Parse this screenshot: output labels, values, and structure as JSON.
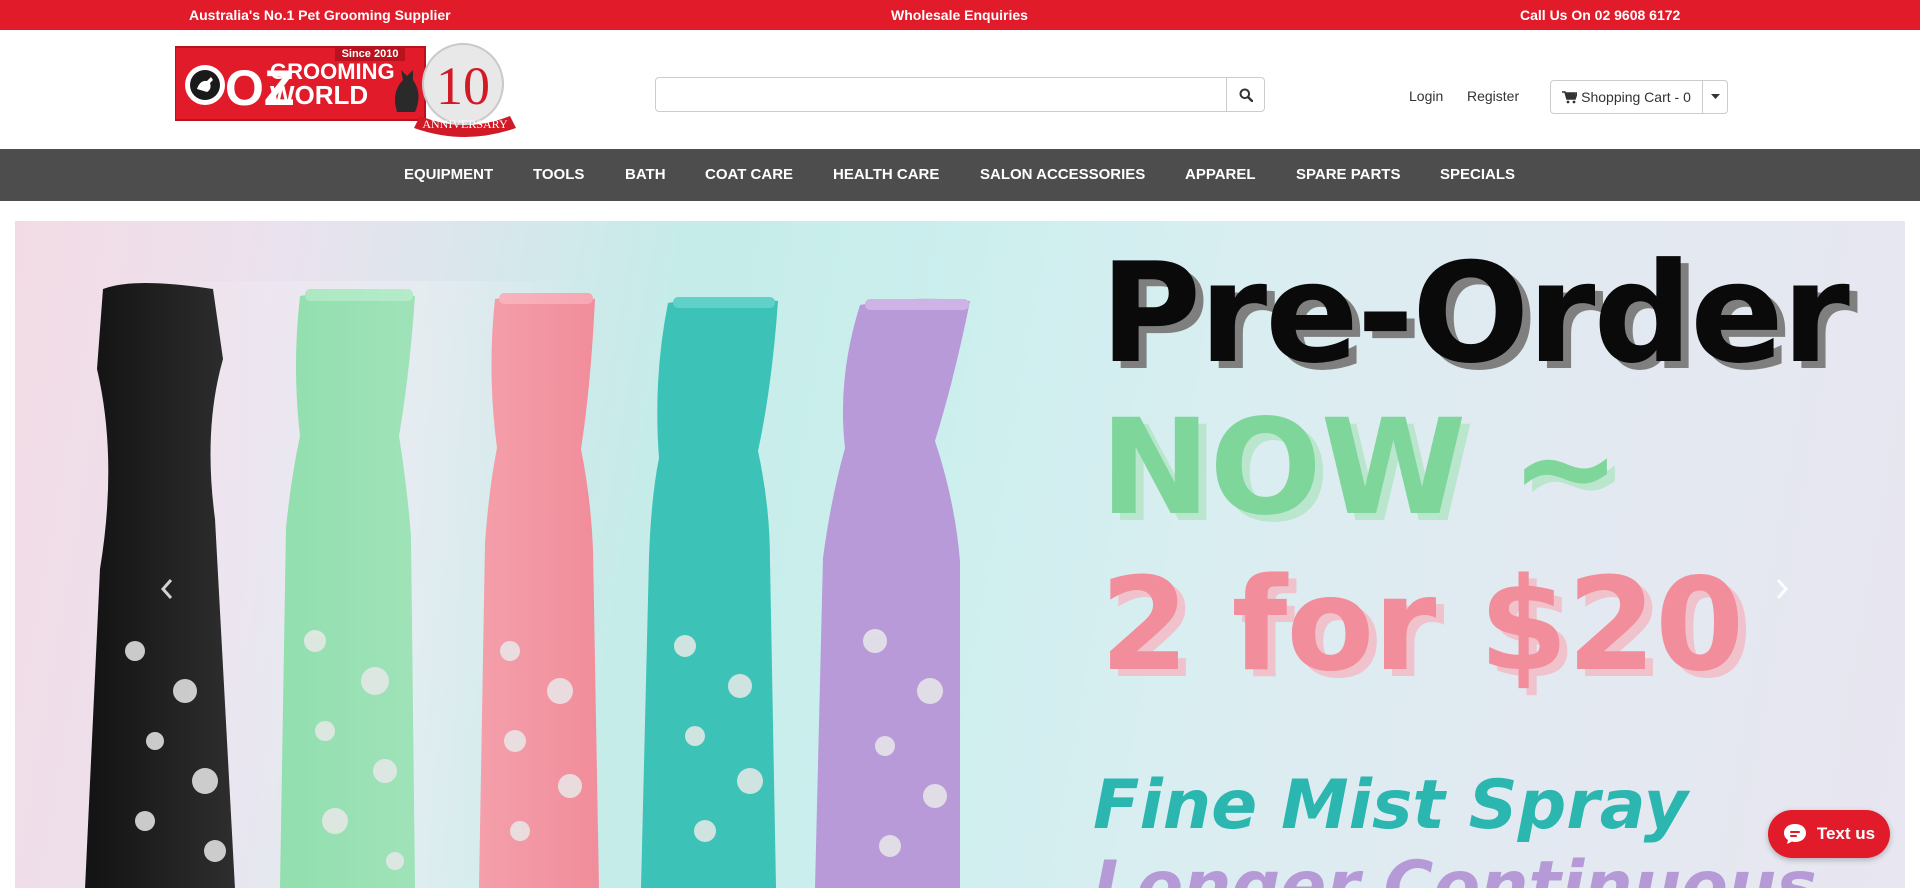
{
  "topbar": {
    "left": "Australia's No.1 Pet Grooming Supplier",
    "middle": "Wholesale Enquiries",
    "right": "Call Us On 02 9608 6172"
  },
  "logo": {
    "since": "Since 2010",
    "oz": "OZ",
    "grooming": "GROOMING",
    "world": "WORLD",
    "years": "10",
    "anniversary": "ANNIVERSARY",
    "brand_color": "#e11b2a"
  },
  "search": {
    "value": "",
    "placeholder": "",
    "icon": "search-icon"
  },
  "header_links": {
    "login": "Login",
    "register": "Register"
  },
  "cart": {
    "label": "Shopping Cart - 0",
    "icon": "cart-icon",
    "caret_icon": "caret-down-icon"
  },
  "nav": {
    "items": [
      "EQUIPMENT",
      "TOOLS",
      "BATH",
      "COAT CARE",
      "HEALTH CARE",
      "SALON ACCESSORIES",
      "APPAREL",
      "SPARE PARTS",
      "SPECIALS"
    ],
    "background": "#4d4d4d"
  },
  "hero": {
    "line1": "Pre-Order",
    "line2": "NOW ~",
    "line3": "2 for $20",
    "line4": "Fine Mist Spray",
    "line5": "Longer Continuous",
    "prev_icon": "chevron-left-icon",
    "next_icon": "chevron-right-icon",
    "bottle_colors": [
      "#141414",
      "#7fd9a1",
      "#f28e9c",
      "#3cc2b7",
      "#b99ad9"
    ]
  },
  "chat": {
    "label": "Text us",
    "icon": "chat-bubble-icon"
  }
}
